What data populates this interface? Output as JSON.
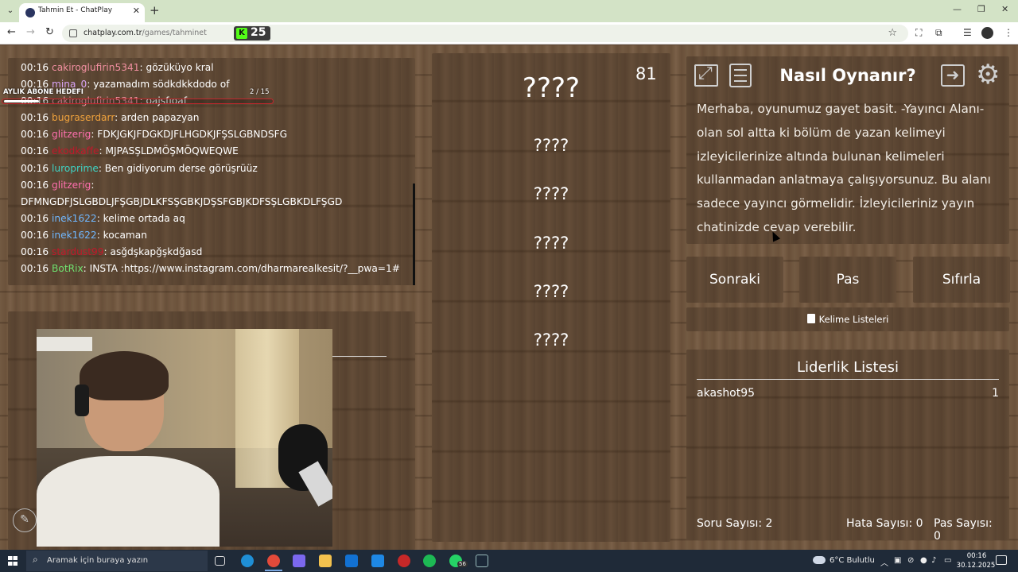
{
  "browser": {
    "tab_title": "Tahmin Et - ChatPlay",
    "url_host": "chatplay.com.tr",
    "url_path": "/games/tahminet",
    "kick_count": "25"
  },
  "chat": {
    "sub_goal_label": "AYLIK ABONE HEDEFI",
    "sub_goal_count": "2 / 15",
    "sub_goal_progress": 0.13,
    "messages": [
      {
        "time": "00:16",
        "user": "cakiroglufirin5341",
        "color": "#f08fa0",
        "text": ": gözüküyo kral"
      },
      {
        "time": "00:16",
        "user": "mina_0",
        "color": "#d7a3f5",
        "text": ": yazamadım södkdkkdodo of"
      },
      {
        "time": "00:16",
        "user": "cakiroglufirin5341",
        "color": "#f08fa0",
        "text": ": oajsfıoaf"
      },
      {
        "time": "00:16",
        "user": "bugraserdarr",
        "color": "#f0a23c",
        "text": ": arden papazyan"
      },
      {
        "time": "00:16",
        "user": "glitzerig",
        "color": "#ff6fae",
        "text": ": FDKJGKJFDGKDJFLHGDKJFŞSLGBNDSFG"
      },
      {
        "time": "00:16",
        "user": "ekodkaffe",
        "color": "#c0182a",
        "text": ": MJPASŞLDMÖŞMÖQWEQWE"
      },
      {
        "time": "00:16",
        "user": "luroprime",
        "color": "#3fd3c4",
        "text": ": Ben gidiyorum derse görüşrüüz"
      },
      {
        "time": "00:16",
        "user": "glitzerig",
        "color": "#ff6fae",
        "text": ":"
      },
      {
        "time": "",
        "user": "",
        "color": "#ffffff",
        "text": "DFMNGDFJSLGBDLJFŞGBJDLKFSŞGBKJDŞSFGBJKDFSŞLGBKDLFŞGD"
      },
      {
        "time": "00:16",
        "user": "inek1622",
        "color": "#6fb7ff",
        "text": ": kelime ortada aq"
      },
      {
        "time": "00:16",
        "user": "inek1622",
        "color": "#6fb7ff",
        "text": ": kocaman"
      },
      {
        "time": "00:16",
        "user": "stardust99",
        "color": "#c0182a",
        "text": ": asğdşkapğşkdğasd"
      },
      {
        "time": "00:16",
        "user": "BotRix",
        "color": "#6fe06f",
        "text": ": INSTA :https://www.instagram.com/dharmarealkesit/?__pwa=1#"
      }
    ]
  },
  "game": {
    "timer": "81",
    "main_word": "????",
    "hidden_words": [
      "????",
      "????",
      "????",
      "????",
      "????"
    ]
  },
  "info": {
    "title": "Nasıl Oynanır?",
    "text": "Merhaba, oyunumuz gayet basit. -Yayıncı Alanı- olan sol altta ki bölüm de yazan kelimeyi izleyicilerinize altında bulunan kelimeleri kullanmadan anlatmaya çalışıyorsunuz. Bu alanı sadece yayıncı görmelidir. İzleyicileriniz yayın chatinizde cevap verebilir."
  },
  "controls": {
    "next": "Sonraki",
    "pass": "Pas",
    "reset": "Sıfırla",
    "word_lists": "Kelime Listeleri"
  },
  "leaderboard": {
    "title": "Liderlik Listesi",
    "rows": [
      {
        "name": "akashot95",
        "score": "1"
      }
    ],
    "question_count": "Soru Sayısı: 2",
    "error_count": "Hata Sayısı: 0",
    "pass_count": "Pas Sayısı: 0"
  },
  "taskbar": {
    "search_placeholder": "Aramak için buraya yazın",
    "weather": "6°C Bulutlu",
    "time": "00:16",
    "date": "30.12.2025",
    "whatsapp_badge": "56"
  }
}
